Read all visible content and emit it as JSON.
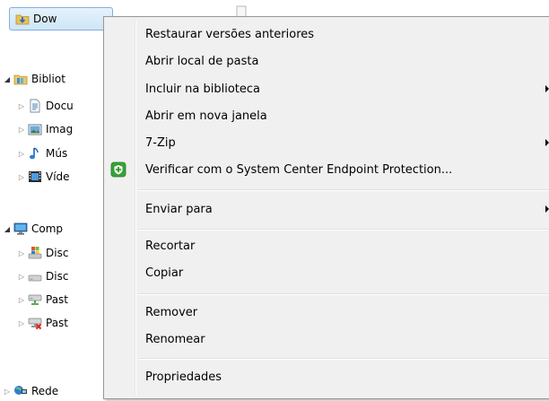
{
  "nav": {
    "downloads_label": "Dow",
    "libraries_label": "Bibliot",
    "documents_label": "Docu",
    "images_label": "Imag",
    "music_label": "Mús",
    "videos_label": "Víde",
    "computer_label": "Comp",
    "disk1_label": "Disc",
    "disk2_label": "Disc",
    "share1_label": "Past",
    "share2_label": "Past",
    "network_label": "Rede"
  },
  "context_menu": {
    "restore_previous": "Restaurar versões anteriores",
    "open_folder_location": "Abrir local de pasta",
    "include_in_library": "Incluir na biblioteca",
    "open_new_window": "Abrir em nova janela",
    "seven_zip": "7-Zip",
    "scan_endpoint": "Verificar com o System Center Endpoint Protection...",
    "send_to": "Enviar para",
    "cut": "Recortar",
    "copy": "Copiar",
    "remove": "Remover",
    "rename": "Renomear",
    "properties": "Propriedades"
  },
  "icons": {
    "library": "library-icon",
    "folder": "folder-icon",
    "computer": "computer-icon",
    "network": "network-icon",
    "shield": "shield-icon"
  },
  "colors": {
    "menu_bg": "#f0f0f0",
    "selection_bg": "#cde6f7",
    "selection_border": "#84acdd",
    "shield_green": "#3aa43a"
  }
}
